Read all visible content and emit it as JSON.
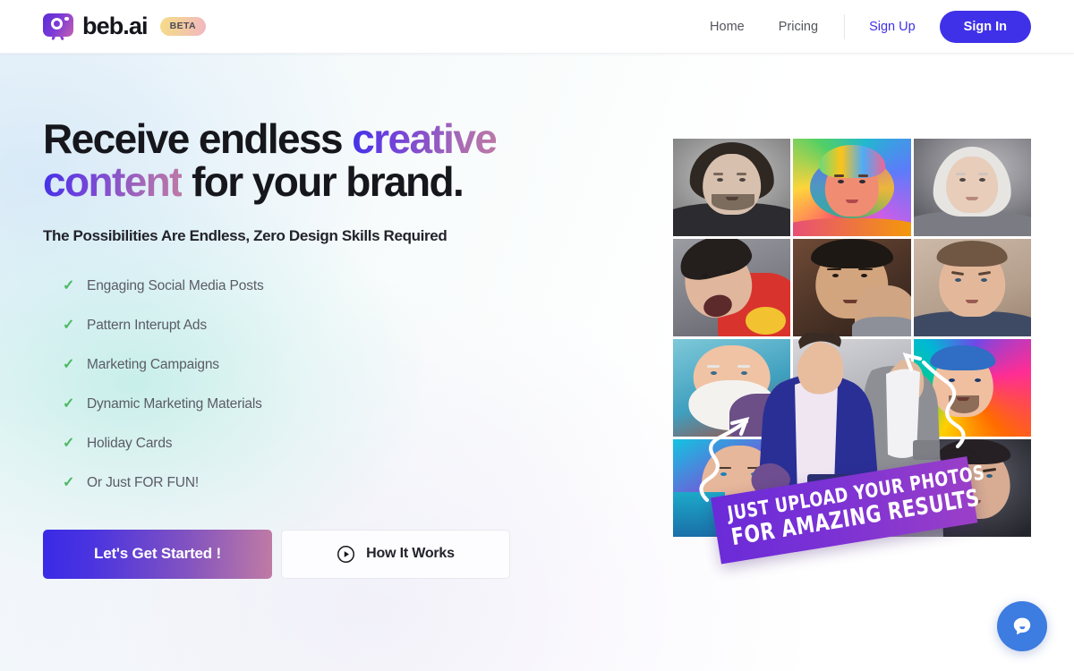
{
  "header": {
    "brand_name": "beb.ai",
    "beta_label": "BETA",
    "logo_icon": "camera-bot-logo-icon",
    "nav": [
      {
        "label": "Home",
        "name": "nav-link-home"
      },
      {
        "label": "Pricing",
        "name": "nav-link-pricing"
      }
    ],
    "sign_up_label": "Sign Up",
    "sign_in_label": "Sign In"
  },
  "hero": {
    "headline": {
      "part1": "Receive endless ",
      "highlight1": "creative",
      "part2": " ",
      "highlight2": "content",
      "part3": " for your brand."
    },
    "subheadline": "The Possibilities Are Endless, Zero Design Skills Required",
    "benefits": [
      {
        "label": "Engaging Social Media Posts"
      },
      {
        "label": "Pattern Interupt Ads"
      },
      {
        "label": "Marketing Campaigns"
      },
      {
        "label": "Dynamic Marketing Materials"
      },
      {
        "label": "Holiday Cards"
      },
      {
        "label": "Or Just FOR FUN!"
      }
    ],
    "check_icon": "✓",
    "primary_cta": "Let's Get Started !",
    "secondary_cta": "How It Works",
    "secondary_cta_icon": "play-circle-icon"
  },
  "collage": {
    "ribbon_line_1": "Just Upload Your Photos",
    "ribbon_line_2": "For Amazing Results",
    "tiles": [
      {
        "name": "portrait-bearded-man-grayscale"
      },
      {
        "name": "portrait-popart-rainbow-man"
      },
      {
        "name": "portrait-white-haired-elf"
      },
      {
        "name": "portrait-shouting-man"
      },
      {
        "name": "portrait-stern-man-painting"
      },
      {
        "name": "portrait-angry-man-beige"
      },
      {
        "name": "portrait-santa-man"
      },
      {
        "name": "portrait-suit-group"
      },
      {
        "name": "portrait-neon-pop-man"
      },
      {
        "name": "portrait-cyber-blue-man"
      },
      {
        "name": "portrait-dark-suit-man"
      },
      {
        "name": "portrait-serious-man-dark"
      }
    ]
  },
  "chat": {
    "icon": "chat-bubble-icon",
    "tooltip": "Chat"
  },
  "colors": {
    "accent_blue": "#3f31e8",
    "gradient_start": "#3a2ae6",
    "gradient_end": "#c07ba4",
    "check_green": "#4cb963",
    "ribbon_purple": "#7b32d4",
    "chat_blue": "#3d7ce0",
    "text_dark": "#16171d",
    "text_muted": "#5a5b66"
  }
}
